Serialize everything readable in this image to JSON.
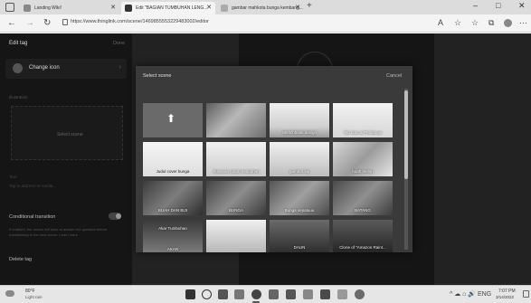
{
  "browser": {
    "tabs": [
      {
        "label": "Landing Wiki!"
      },
      {
        "label": "Edit \"BAGIAN TUMBUHAN LENG..."
      },
      {
        "label": "gambar mahkota bunga kembang..."
      }
    ],
    "new_tab": "+",
    "url": "https://www.thinglink.com/scene/1469855553229483002/editor",
    "window_controls": {
      "minimize": "–",
      "maximize": "□",
      "close": "✕"
    }
  },
  "editor": {
    "title": "Edit tag",
    "done_label": "Done",
    "change_icon_label": "Change icon",
    "illustration_label": "Illustration",
    "select_scene_label": "Select scene",
    "text_label": "Text",
    "text_placeholder": "Tap to add text or media...",
    "conditional_label": "Conditional transition",
    "conditional_desc": "If enabled, the viewer will have to answer the question before transitioning to the next scene. Learn more",
    "delete_label": "Delete tag"
  },
  "modal": {
    "title": "Select scene",
    "cancel_label": "Cancel",
    "scenes": [
      {
        "caption": "",
        "upload": true
      },
      {
        "caption": "",
        "bg": "linear-gradient(135deg,#5c5c5c,#b8b8b8 45%,#6e6e6e)"
      },
      {
        "caption": "Sketchbook design",
        "bg": "linear-gradient(180deg,#f0f0f0,#cfcfcf 70%,#9a9a9a)"
      },
      {
        "caption": "Tab Ikan & Perikanan",
        "bg": "linear-gradient(180deg,#f3f3f3,#d6d6d6)"
      },
      {
        "caption": "Judul cover bunga",
        "bg": "linear-gradient(180deg,#f5f5f5,#dedede)",
        "dark": true
      },
      {
        "caption": "Susunan tubuh tumbuhan",
        "bg": "linear-gradient(180deg,#f2f2f2,#cacaca)"
      },
      {
        "caption": "gambar biji",
        "bg": "linear-gradient(180deg,#f1f1f1,#bdbdbd)"
      },
      {
        "caption": "buah melon",
        "bg": "linear-gradient(135deg,#d8d8d8,#9b9b9b 50%,#e6e6e6)"
      },
      {
        "caption": "BUAH DAN BIJI",
        "bg": "linear-gradient(135deg,#3c3c3c,#7d7d7d 50%,#2e2e2e)"
      },
      {
        "caption": "BUNGA",
        "bg": "linear-gradient(135deg,#444,#8d8d8d 50%,#3a3a3a)"
      },
      {
        "caption": "Bunga sepatuuu",
        "bg": "linear-gradient(135deg,#555,#a0a0a0 50%,#4a4a4a)"
      },
      {
        "caption": "BATANG",
        "bg": "linear-gradient(135deg,#4a4a4a,#909090 50%,#3c3c3c)"
      },
      {
        "caption": "Akar Tumbuhan",
        "caption2": "AKAR",
        "bg": "linear-gradient(180deg,#3a3a3a,#7a7a7a)"
      },
      {
        "caption": "",
        "bg": "linear-gradient(180deg,#f0f0f0,#b8b8b8)"
      },
      {
        "caption": "DAUN",
        "bg": "linear-gradient(180deg,#6a6a6a,#2f2f2f)"
      },
      {
        "caption": "Clone of \"Amazon Raint...",
        "bg": "linear-gradient(180deg,#5a5a5a,#262626)"
      }
    ]
  },
  "taskbar": {
    "weather_temp": "80°F",
    "weather_cond": "Light rain",
    "tray": "^ ☁ ⌂ 🔊 ENG",
    "clock_time": "7:07 PM",
    "clock_date": "3/14/2022"
  }
}
